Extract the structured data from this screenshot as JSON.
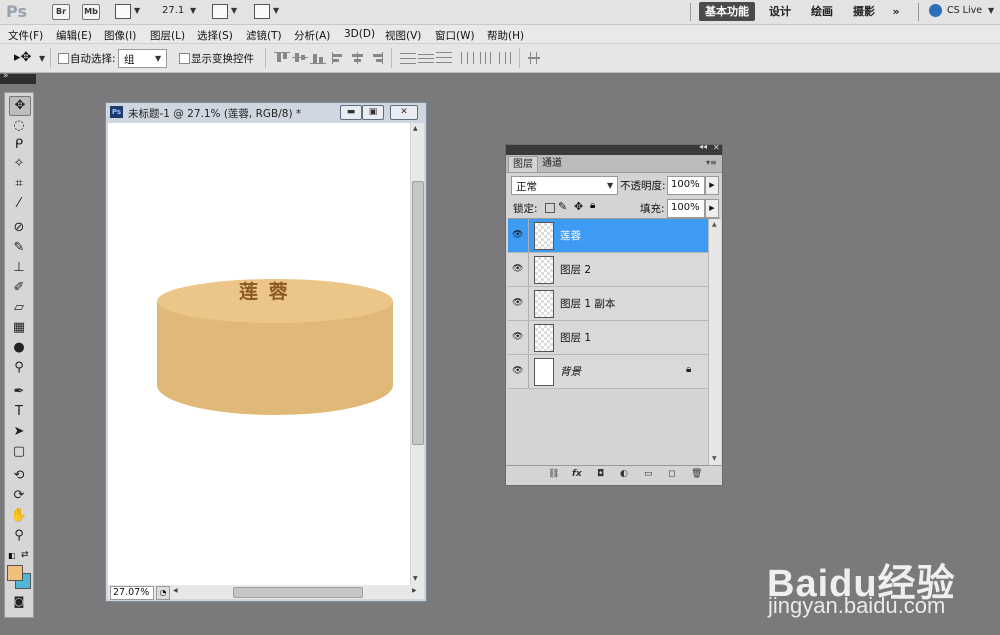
{
  "app": {
    "logo": "Ps",
    "bridge_badge": "Br",
    "minibridge_badge": "Mb",
    "zoom_value": "27.1",
    "workspaces": [
      "基本功能",
      "设计",
      "绘画",
      "摄影"
    ],
    "more_glyph": "»",
    "cslive": "CS Live"
  },
  "menu": [
    "文件(F)",
    "编辑(E)",
    "图像(I)",
    "图层(L)",
    "选择(S)",
    "滤镜(T)",
    "分析(A)",
    "3D(D)",
    "视图(V)",
    "窗口(W)",
    "帮助(H)"
  ],
  "options": {
    "auto_select_label": "自动选择:",
    "auto_select_value": "组",
    "show_transform_label": "显示变换控件"
  },
  "document": {
    "title": "未标题-1 @ 27.1% (莲蓉, RGB/8) *",
    "zoom_status": "27.07%",
    "artwork_text": "莲 蓉",
    "colors": {
      "cake": "#ebc688",
      "cake_shadow": "#e0b877",
      "text": "#8a5a22"
    }
  },
  "layers_panel": {
    "tabs": [
      "图层",
      "通道"
    ],
    "blend_mode": "正常",
    "opacity_label": "不透明度:",
    "opacity_value": "100%",
    "lock_label": "锁定:",
    "fill_label": "填充:",
    "fill_value": "100%",
    "layers": [
      {
        "name": "莲蓉",
        "selected": true,
        "locked": false
      },
      {
        "name": "图层 2",
        "selected": false,
        "locked": false
      },
      {
        "name": "图层 1 副本",
        "selected": false,
        "locked": false
      },
      {
        "name": "图层 1",
        "selected": false,
        "locked": false
      },
      {
        "name": "背景",
        "selected": false,
        "locked": true
      }
    ]
  },
  "colors": {
    "foreground": "#f0c07a",
    "background": "#4fb8d8",
    "selection": "#3d9bf3"
  },
  "watermark": {
    "logo": "Baidu经验",
    "url": "jingyan.baidu.com"
  }
}
